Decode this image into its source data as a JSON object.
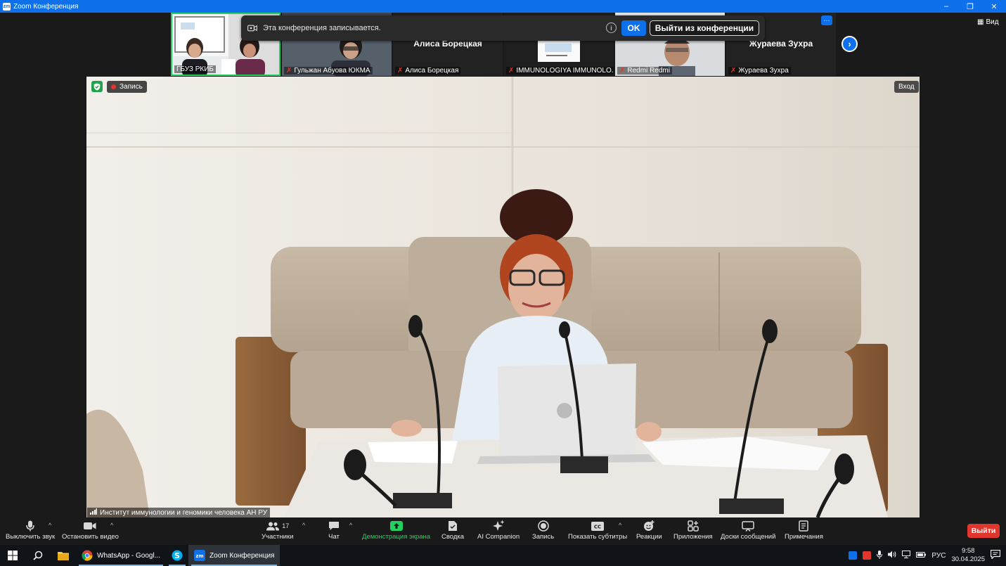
{
  "window": {
    "title": "Zoom Конференция",
    "app_icon_label": "zm",
    "minimize": "–",
    "restore": "❐",
    "close": "✕"
  },
  "notice": {
    "text": "Эта конференция записывается.",
    "info": "i",
    "ok_label": "OK",
    "leave_label": "Выйти из конференции"
  },
  "gallery": {
    "tiles": [
      {
        "name": "ГБУЗ РКИБ",
        "muted": false
      },
      {
        "name": "Гульжан Абуова ЮКМА",
        "muted": true
      },
      {
        "name": "Алиса Борецкая",
        "muted": true,
        "big_name": "Алиса Борецкая"
      },
      {
        "name": "IMMUNOLOGIYA IMMUNOLO...",
        "muted": true
      },
      {
        "name": "Redmi Redmi",
        "muted": true
      },
      {
        "name": "Жураева Зухра",
        "muted": true,
        "big_name": "Жураева Зухра"
      }
    ],
    "menu_icon": "···",
    "next_icon": "›",
    "view_label": "Вид"
  },
  "main_video": {
    "recording_label": "Запись",
    "enter_label": "Вход",
    "speaker_name": "Институт иммунологии и геномики человека АН РУ"
  },
  "toolbar": {
    "mute": "Выключить звук",
    "stop_video": "Остановить видео",
    "participants": "Участники",
    "participants_count": "17",
    "chat": "Чат",
    "share": "Демонстрация экрана",
    "summary": "Сводка",
    "ai": "AI Companion",
    "record": "Запись",
    "captions": "Показать субтитры",
    "reactions": "Реакции",
    "apps": "Приложения",
    "boards": "Доски сообщений",
    "notes": "Примечания",
    "leave": "Выйти",
    "caret": "^"
  },
  "taskbar": {
    "apps": [
      {
        "label": "WhatsApp - Googl..."
      },
      {
        "label": ""
      },
      {
        "label": "Zoom Конференция"
      }
    ],
    "lang": "РУС",
    "time": "9:58",
    "date": "30.04.2025"
  },
  "colors": {
    "zoom_blue": "#0e71eb",
    "record_red": "#e0362d",
    "share_green": "#23d160"
  }
}
